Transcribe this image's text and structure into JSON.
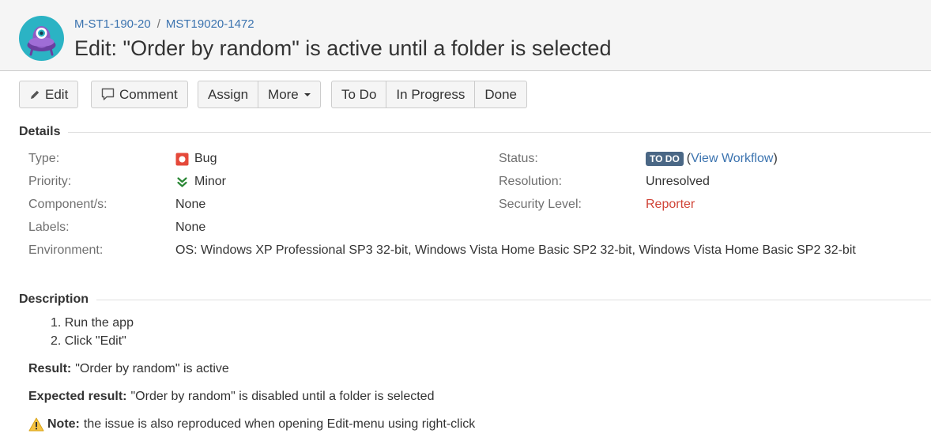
{
  "breadcrumb": {
    "project": "M-ST1-190-20",
    "separator": "/",
    "issue_key": "MST19020-1472"
  },
  "issue_title": "Edit: \"Order by random\" is active until a folder is selected",
  "toolbar": {
    "edit": "Edit",
    "comment": "Comment",
    "assign": "Assign",
    "more": "More",
    "todo": "To Do",
    "in_progress": "In Progress",
    "done": "Done"
  },
  "details": {
    "heading": "Details",
    "type": {
      "label": "Type:",
      "value": "Bug",
      "icon": "bug-icon"
    },
    "priority": {
      "label": "Priority:",
      "value": "Minor",
      "icon": "priority-minor-icon"
    },
    "components": {
      "label": "Component/s:",
      "value": "None"
    },
    "labels": {
      "label": "Labels:",
      "value": "None"
    },
    "environment": {
      "label": "Environment:",
      "value": "OS: Windows XP Professional SP3 32-bit, Windows Vista Home Basic SP2 32-bit, Windows Vista Home Basic SP2 32-bit"
    },
    "status": {
      "label": "Status:",
      "lozenge": "TO DO",
      "open_paren": "(",
      "workflow_link": "View Workflow",
      "close_paren": ")"
    },
    "resolution": {
      "label": "Resolution:",
      "value": "Unresolved"
    },
    "security": {
      "label": "Security Level:",
      "value": "Reporter"
    }
  },
  "description": {
    "heading": "Description",
    "steps": [
      "1. Run the app",
      "2. Click \"Edit\""
    ],
    "result_label": "Result:",
    "result_text": "\"Order by random\" is active",
    "expected_label": "Expected result:",
    "expected_text": "\"Order by random\" is disabled until a folder is selected",
    "note_label": "Note:",
    "note_text": "the issue is also reproduced when opening Edit-menu using right-click"
  },
  "colors": {
    "link": "#3b73af",
    "lozenge": "#4a6785",
    "security_red": "#d04437",
    "avatar_bg": "#2bb3c4",
    "avatar_body": "#8e5bc4"
  }
}
